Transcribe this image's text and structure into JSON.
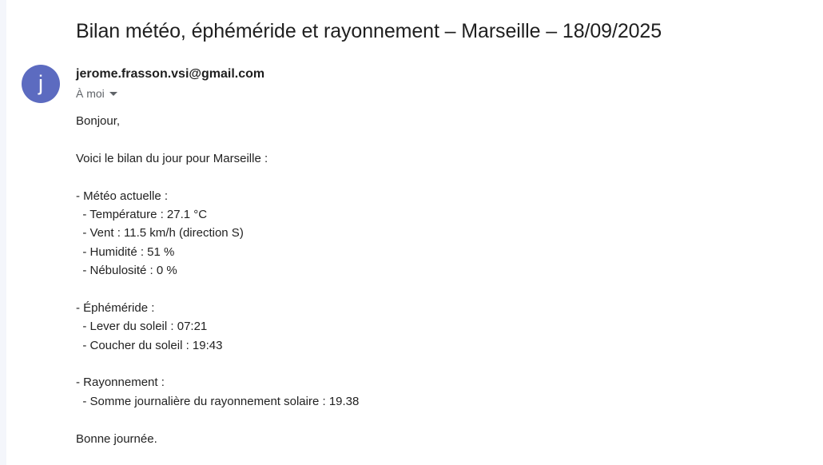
{
  "email": {
    "subject": "Bilan météo, éphéméride et rayonnement – Marseille – 18/09/2025",
    "avatar_initial": "j",
    "sender": "jerome.frasson.vsi@gmail.com",
    "recipient": "À moi",
    "avatar_color": "#5c6bc0",
    "body_lines": [
      "Bonjour,",
      "",
      "Voici le bilan du jour pour Marseille :",
      "",
      "- Météo actuelle :",
      "  - Température : 27.1 °C",
      "  - Vent : 11.5 km/h (direction S)",
      "  - Humidité : 51 %",
      "  - Nébulosité : 0 %",
      "",
      "- Éphéméride :",
      "  - Lever du soleil : 07:21",
      "  - Coucher du soleil : 19:43",
      "",
      "- Rayonnement :",
      "  - Somme journalière du rayonnement solaire : 19.38",
      "",
      "Bonne journée."
    ]
  },
  "icons": {
    "recipient_dropdown": "caret-down-icon"
  }
}
